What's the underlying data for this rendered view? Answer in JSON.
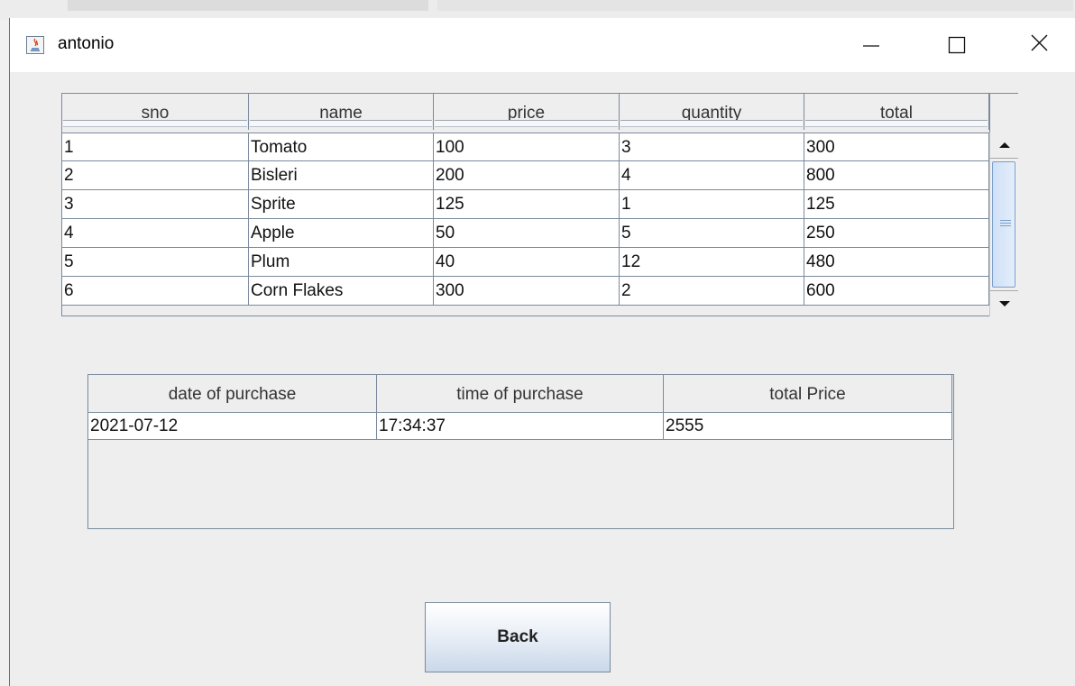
{
  "window": {
    "title": "antonio"
  },
  "items_table": {
    "columns": [
      "sno",
      "name",
      "price",
      "quantity",
      "total"
    ],
    "rows": [
      [
        "1",
        "Tomato",
        "100",
        "3",
        "300"
      ],
      [
        "2",
        "Bisleri",
        "200",
        "4",
        "800"
      ],
      [
        "3",
        "Sprite",
        "125",
        "1",
        "125"
      ],
      [
        "4",
        "Apple",
        "50",
        "5",
        "250"
      ],
      [
        "5",
        "Plum",
        "40",
        "12",
        "480"
      ],
      [
        "6",
        "Corn Flakes",
        "300",
        "2",
        "600"
      ]
    ]
  },
  "summary_table": {
    "columns": [
      "date of purchase",
      "time of purchase",
      "total Price"
    ],
    "rows": [
      [
        "2021-07-12",
        "17:34:37",
        "2555"
      ]
    ]
  },
  "actions": {
    "back_label": "Back"
  },
  "icons": {
    "app": "java-app-icon",
    "minimize": "minimize-icon",
    "maximize": "maximize-icon",
    "close": "close-icon",
    "scroll_up": "scroll-up-arrow-icon",
    "scroll_down": "scroll-down-arrow-icon"
  }
}
